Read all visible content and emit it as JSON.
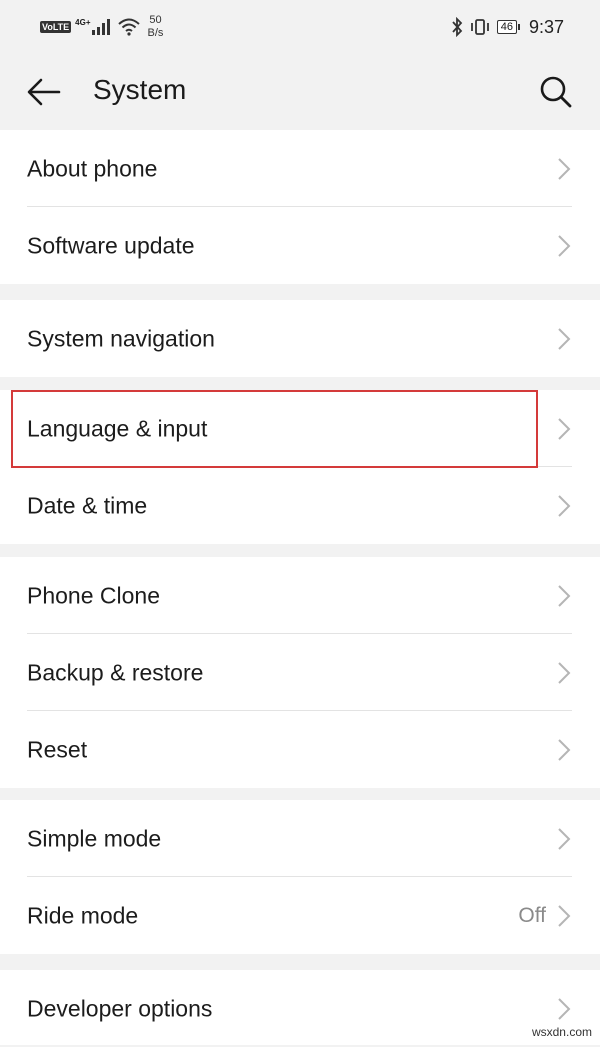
{
  "status_bar": {
    "volte": "VoLTE",
    "network": "4G+",
    "speed_value": "50",
    "speed_unit": "B/s",
    "battery": "46",
    "time": "9:37"
  },
  "app_bar": {
    "title": "System"
  },
  "groups": [
    {
      "items": [
        {
          "label": "About phone"
        },
        {
          "label": "Software update"
        }
      ]
    },
    {
      "items": [
        {
          "label": "System navigation"
        }
      ]
    },
    {
      "items": [
        {
          "label": "Language & input"
        },
        {
          "label": "Date & time"
        }
      ]
    },
    {
      "items": [
        {
          "label": "Phone Clone"
        },
        {
          "label": "Backup & restore"
        },
        {
          "label": "Reset"
        }
      ]
    },
    {
      "items": [
        {
          "label": "Simple mode"
        },
        {
          "label": "Ride mode",
          "value": "Off"
        }
      ]
    },
    {
      "items": [
        {
          "label": "Developer options"
        }
      ]
    }
  ],
  "colors": {
    "background": "#f2f2f2",
    "card": "#ffffff",
    "highlight": "#d43a3a"
  },
  "watermark": "wsxdn.com"
}
